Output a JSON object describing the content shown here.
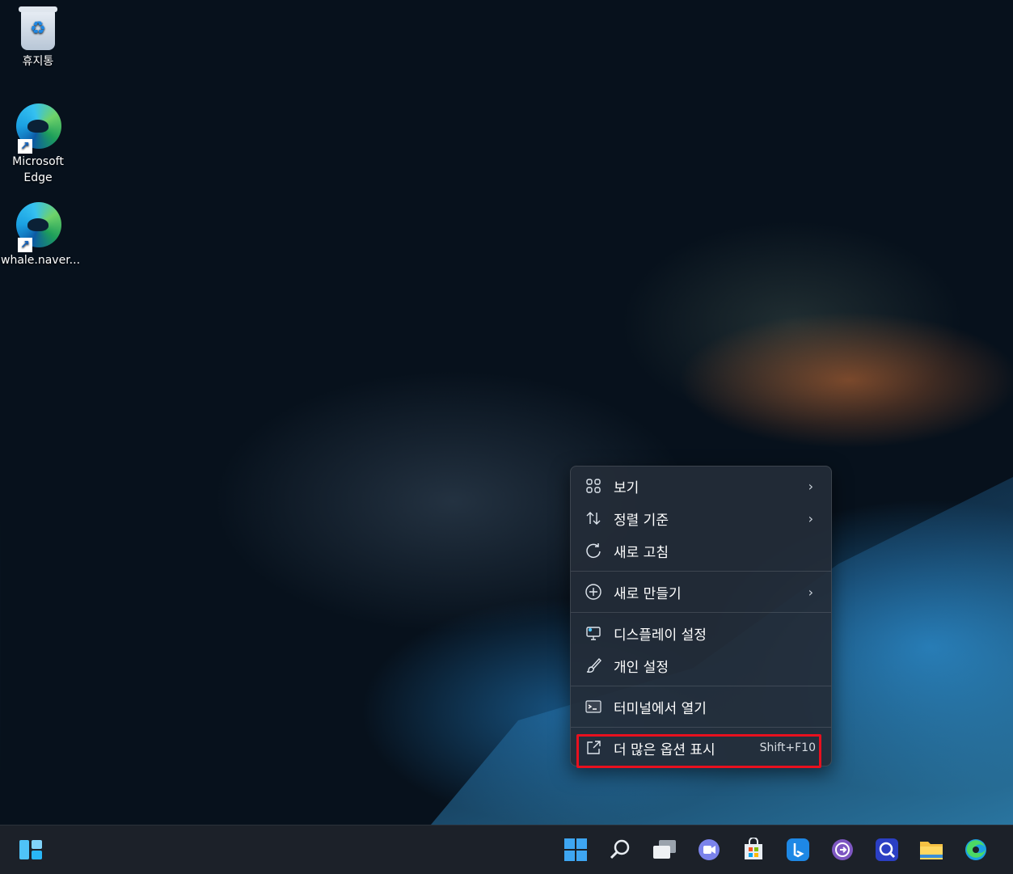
{
  "desktop": {
    "icons": [
      {
        "label": "휴지통"
      },
      {
        "label": "Microsoft\nEdge"
      },
      {
        "label": "whale.naver..."
      }
    ]
  },
  "context_menu": {
    "items": [
      {
        "label": "보기",
        "icon": "grid-icon",
        "submenu": true
      },
      {
        "label": "정렬 기준",
        "icon": "sort-icon",
        "submenu": true
      },
      {
        "label": "새로 고침",
        "icon": "refresh-icon",
        "submenu": false
      },
      {
        "label": "새로 만들기",
        "icon": "add-circle-icon",
        "submenu": true
      },
      {
        "label": "디스플레이 설정",
        "icon": "display-icon",
        "submenu": false
      },
      {
        "label": "개인 설정",
        "icon": "brush-icon",
        "submenu": false
      },
      {
        "label": "터미널에서 열기",
        "icon": "terminal-icon",
        "submenu": false
      },
      {
        "label": "더 많은 옵션 표시",
        "icon": "share-icon",
        "shortcut": "Shift+F10",
        "highlighted": true
      }
    ],
    "highlight_color": "#e8101e"
  },
  "taskbar": {
    "icons": [
      "widgets-icon",
      "start-icon",
      "search-icon",
      "task-view-icon",
      "chat-icon",
      "store-icon",
      "bing-icon",
      "app-icon",
      "search-app-icon",
      "file-explorer-icon",
      "edge-icon"
    ]
  }
}
